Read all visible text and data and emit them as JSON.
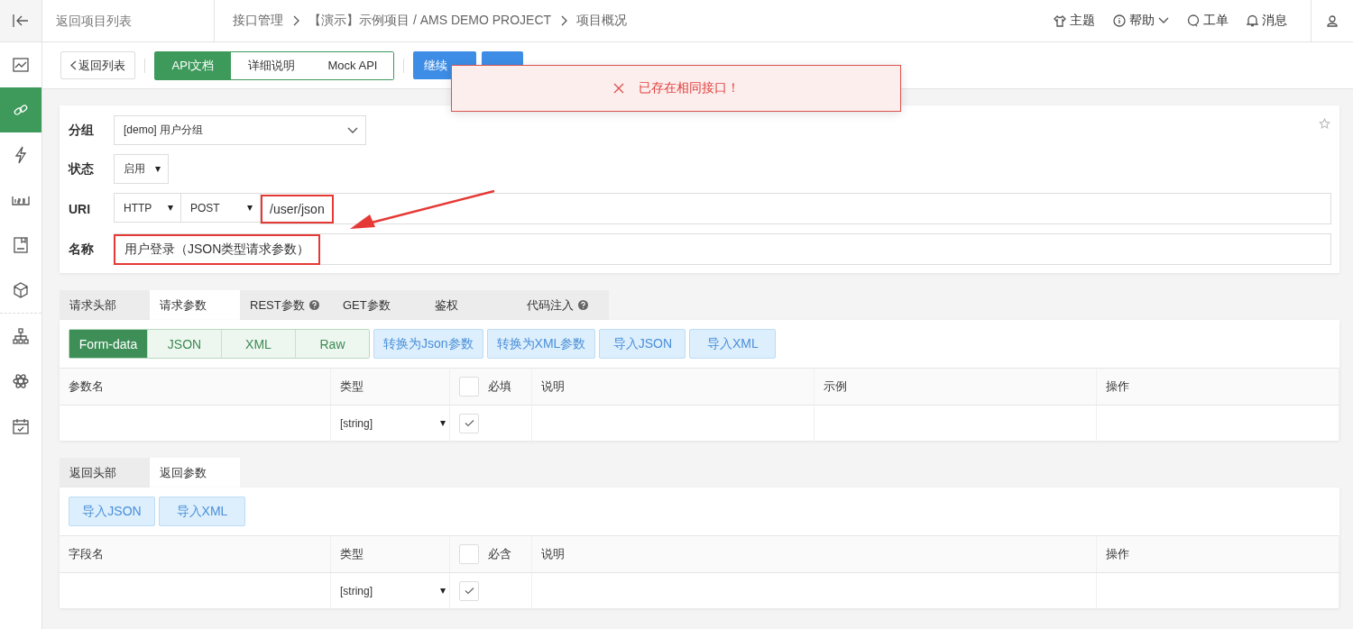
{
  "sidebar": {
    "groups": [
      {
        "items": [
          {
            "kind": "chart",
            "selected": false
          },
          {
            "kind": "link",
            "selected": true
          },
          {
            "kind": "bolt",
            "selected": false
          },
          {
            "kind": "counter",
            "selected": false
          },
          {
            "kind": "document",
            "selected": false
          },
          {
            "kind": "cube",
            "selected": false
          }
        ]
      },
      {
        "items": [
          {
            "kind": "tree",
            "selected": false
          },
          {
            "kind": "atom",
            "selected": false
          },
          {
            "kind": "calendar",
            "selected": false
          }
        ]
      }
    ]
  },
  "topbar": {
    "back_link": "返回项目列表",
    "breadcrumb": [
      "接口管理",
      "【演示】示例项目 / AMS DEMO PROJECT",
      "项目概况"
    ],
    "actions": [
      {
        "kind": "shirt",
        "label": "主题",
        "dropdown": false
      },
      {
        "kind": "info",
        "label": "帮助",
        "dropdown": true
      },
      {
        "kind": "chat",
        "label": "工单",
        "dropdown": false
      },
      {
        "kind": "bell",
        "label": "消息",
        "dropdown": false
      }
    ]
  },
  "toolbar": {
    "back_button": "返回列表",
    "view_tabs": [
      {
        "label": "API文档",
        "selected": true
      },
      {
        "label": "详细说明",
        "selected": false
      },
      {
        "label": "Mock API",
        "selected": false
      }
    ],
    "buttons": [
      {
        "kind": "new",
        "label": "继续"
      },
      {
        "kind": "save"
      }
    ]
  },
  "toast": {
    "kind": "error",
    "message": "已存在相同接口！"
  },
  "form": {
    "starred": false,
    "group": {
      "label": "分组",
      "value": "[demo] 用户分组"
    },
    "status": {
      "label": "状态",
      "value": "启用"
    },
    "uri": {
      "label": "URI",
      "protocol": "HTTP",
      "method": "POST",
      "path": "/user/json",
      "highlighted": true
    },
    "name": {
      "label": "名称",
      "value": "用户登录（JSON类型请求参数）",
      "highlighted": true
    },
    "annotation_arrow": true
  },
  "request": {
    "tabs": [
      {
        "label": "请求头部",
        "selected": false,
        "help": false
      },
      {
        "label": "请求参数",
        "selected": true,
        "help": false
      },
      {
        "label": "REST参数",
        "selected": false,
        "help": true
      },
      {
        "label": "GET参数",
        "selected": false,
        "help": false
      },
      {
        "label": "鉴权",
        "selected": false,
        "help": false
      },
      {
        "label": "代码注入",
        "selected": false,
        "help": true
      }
    ],
    "formats": [
      {
        "label": "Form-data",
        "selected": true
      },
      {
        "label": "JSON",
        "selected": false
      },
      {
        "label": "XML",
        "selected": false
      },
      {
        "label": "Raw",
        "selected": false
      }
    ],
    "actions": [
      "转换为Json参数",
      "转换为XML参数",
      "导入JSON",
      "导入XML"
    ],
    "table": {
      "columns": [
        {
          "kind": "name",
          "label": "参数名"
        },
        {
          "kind": "type",
          "label": "类型"
        },
        {
          "kind": "check",
          "label": "必填",
          "checked": false
        },
        {
          "kind": "text",
          "label": "说明"
        },
        {
          "kind": "text",
          "label": "示例"
        },
        {
          "kind": "ops",
          "label": "操作"
        }
      ],
      "rows": [
        {
          "type": "[string]",
          "checked": true
        }
      ]
    }
  },
  "response": {
    "tabs": [
      {
        "label": "返回头部",
        "selected": false,
        "help": false
      },
      {
        "label": "返回参数",
        "selected": true,
        "help": false
      }
    ],
    "actions": [
      "导入JSON",
      "导入XML"
    ],
    "table": {
      "columns": [
        {
          "kind": "name",
          "label": "字段名"
        },
        {
          "kind": "type",
          "label": "类型"
        },
        {
          "kind": "check",
          "label": "必含",
          "checked": false
        },
        {
          "kind": "wide",
          "label": "说明"
        },
        {
          "kind": "ops",
          "label": "操作"
        }
      ],
      "rows": [
        {
          "type": "[string]",
          "checked": true
        }
      ]
    }
  }
}
